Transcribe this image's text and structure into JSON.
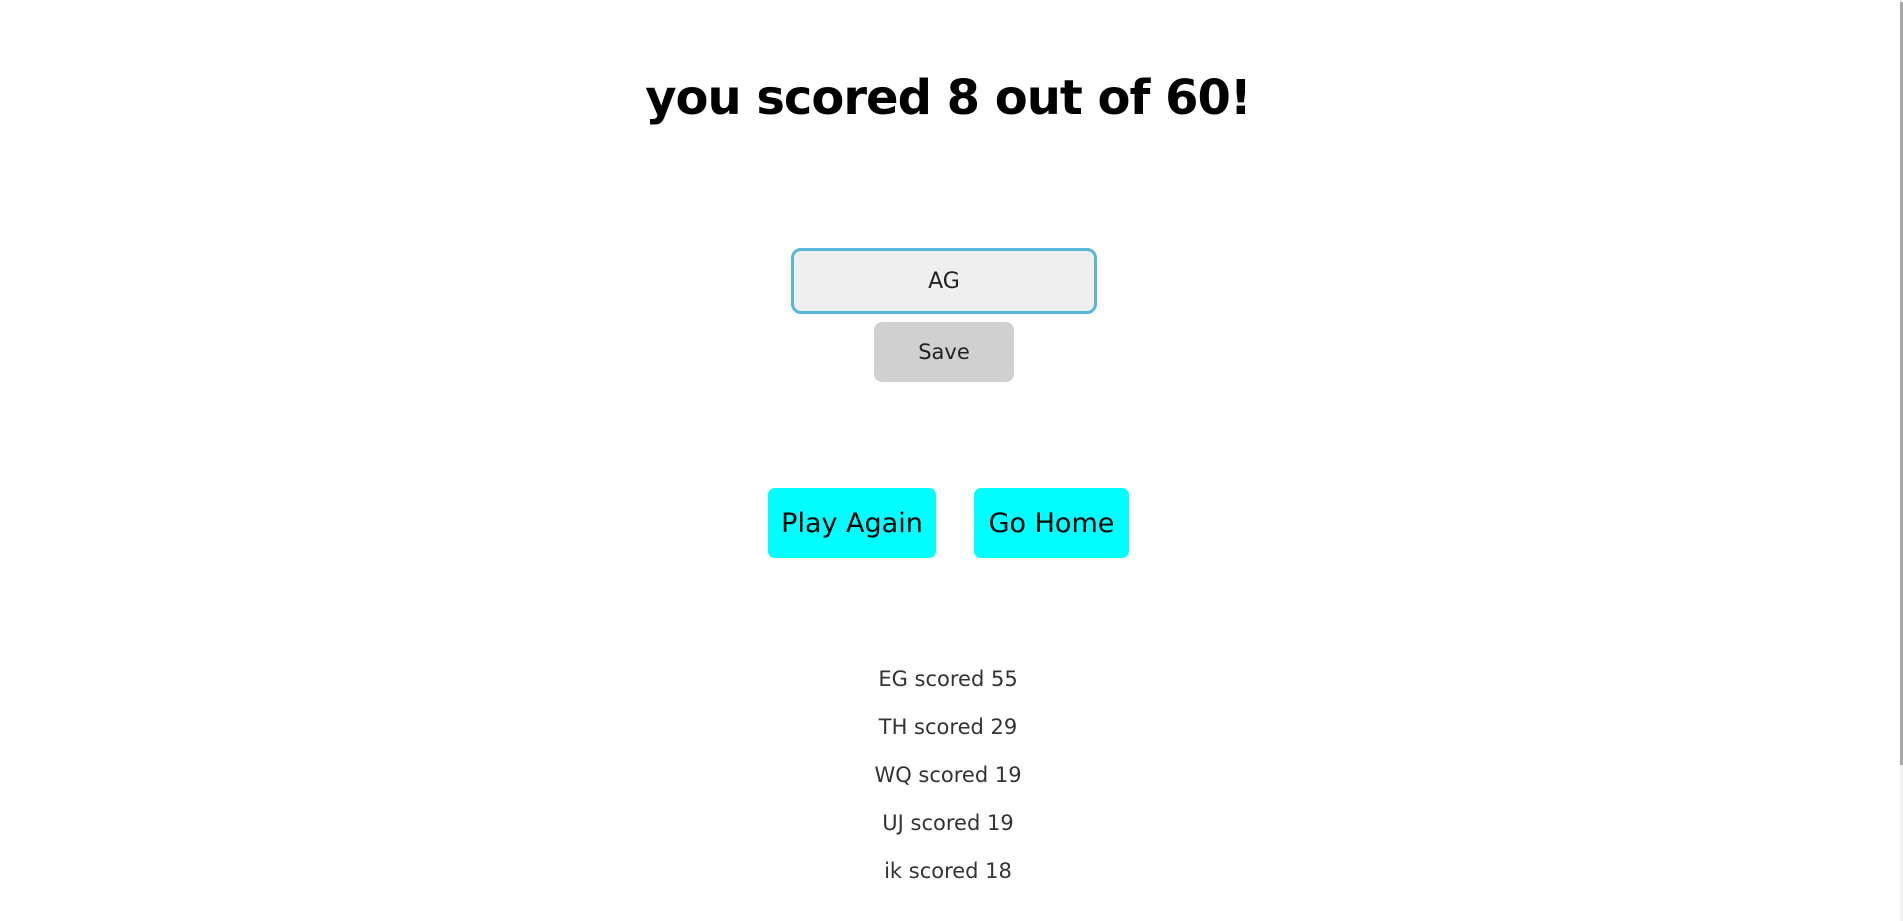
{
  "result": {
    "title": "you scored 8 out of 60!"
  },
  "save_form": {
    "name_value": "AG",
    "save_label": "Save"
  },
  "actions": {
    "play_again_label": "Play Again",
    "go_home_label": "Go Home",
    "button_color": "#00ffff"
  },
  "leaderboard": [
    {
      "text": "EG scored 55"
    },
    {
      "text": "TH scored 29"
    },
    {
      "text": "WQ scored 19"
    },
    {
      "text": "UJ scored 19"
    },
    {
      "text": "ik scored 18"
    }
  ]
}
